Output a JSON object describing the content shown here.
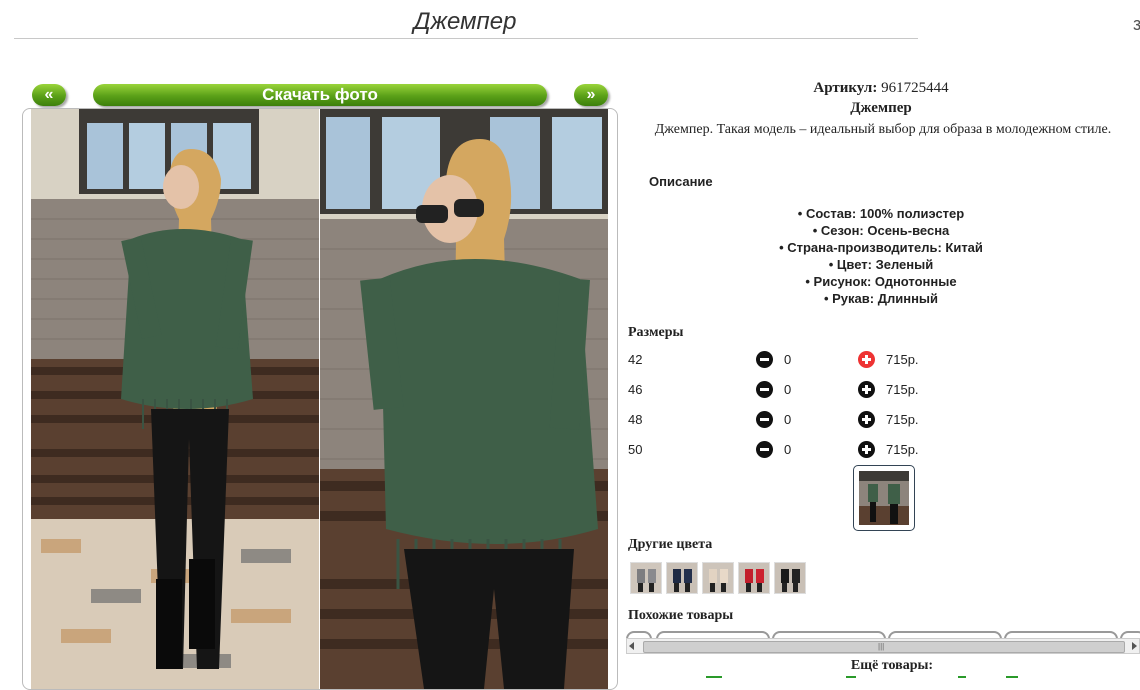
{
  "header": {
    "title": "Джемпер",
    "edge_mark": "з"
  },
  "gallery": {
    "prev_label": "«",
    "next_label": "»",
    "download_label": "Скачать фото"
  },
  "product": {
    "article_label": "Артикул:",
    "article_value": "961725444",
    "name": "Джемпер",
    "description": "Джемпер. Такая модель – идеальный выбор для образа в молодежном стиле."
  },
  "description_section": {
    "heading": "Описание",
    "properties": [
      "• Состав: 100% полиэстер",
      "• Сезон: Осень-весна",
      "• Страна-производитель: Китай",
      "• Цвет: Зеленый",
      "• Рисунок: Однотонные",
      "• Рукав: Длинный"
    ]
  },
  "sizes": {
    "heading": "Размеры",
    "rows": [
      {
        "size": "42",
        "qty": "0",
        "price": "715р.",
        "plus_active": true
      },
      {
        "size": "46",
        "qty": "0",
        "price": "715р.",
        "plus_active": false
      },
      {
        "size": "48",
        "qty": "0",
        "price": "715р.",
        "plus_active": false
      },
      {
        "size": "50",
        "qty": "0",
        "price": "715р.",
        "plus_active": false
      }
    ]
  },
  "other_colors": {
    "heading": "Другие цвета"
  },
  "similar": {
    "heading": "Похожие товары"
  },
  "more": {
    "heading": "Ещё товары:"
  },
  "colors": {
    "accent_green": "#5aa018",
    "sweater_green": "#3f5f48",
    "plus_red": "#e33333"
  }
}
